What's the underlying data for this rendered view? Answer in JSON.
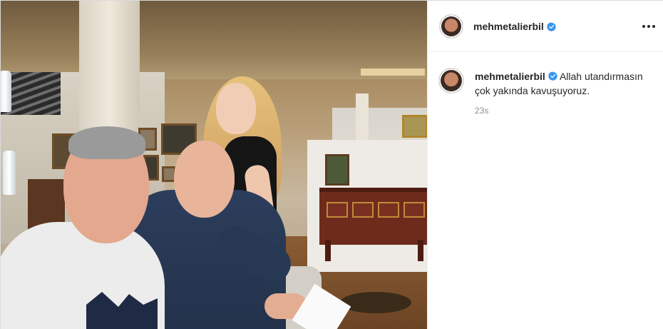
{
  "post": {
    "author": {
      "username": "mehmetalierbil",
      "verified": true,
      "verified_icon": "verified-badge-icon",
      "verified_color": "#3897f0"
    },
    "more_options_icon": "more-horizontal-icon",
    "caption": {
      "username": "mehmetalierbil",
      "text": "Allah utandırmasın çok yakında kavuşuyoruz.",
      "timestamp": "23s"
    },
    "photo": {
      "description_icon": "post-photo"
    }
  },
  "colors": {
    "text_primary": "#262626",
    "text_secondary": "#8e8e8e",
    "border": "#dbdbdb",
    "verified": "#3897f0"
  }
}
